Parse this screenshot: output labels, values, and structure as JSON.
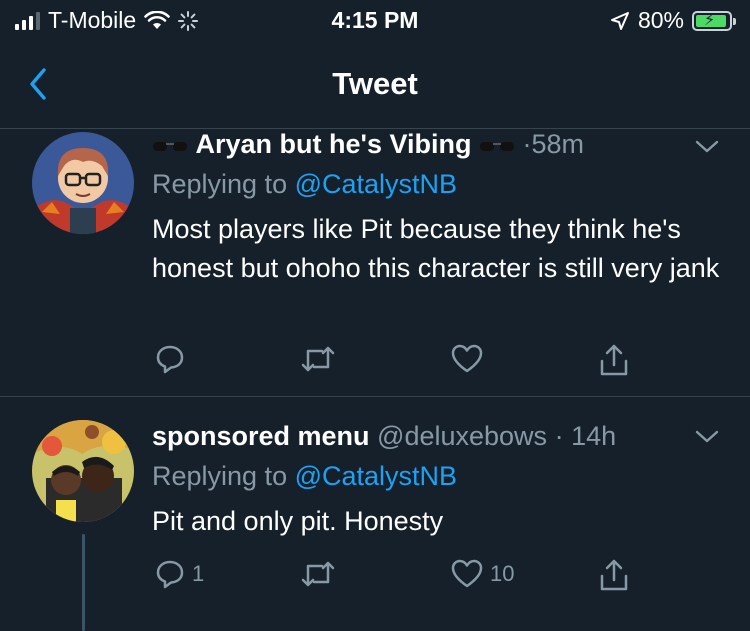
{
  "status_bar": {
    "carrier": "T-Mobile",
    "time": "4:15 PM",
    "battery_percent": "80%"
  },
  "header": {
    "title": "Tweet"
  },
  "tweets": [
    {
      "name": "Aryan but he's Vibing",
      "handle": "",
      "time": "58m",
      "reply_prefix": "Replying to",
      "mention": "@CatalystNB",
      "text": "Most players like Pit because they think he's honest but ohoho this character is still very jank",
      "reply_count": "",
      "like_count": ""
    },
    {
      "name": "sponsored menu",
      "handle": "@deluxebows",
      "time": "14h",
      "reply_prefix": "Replying to",
      "mention": "@CatalystNB",
      "text": "Pit and only pit. Honesty",
      "reply_count": "1",
      "like_count": "10"
    }
  ],
  "colors": {
    "background": "#15202b",
    "accent": "#1da1f2",
    "secondary_text": "#8899a6",
    "divider": "#38444d",
    "battery_fill": "#4cd964"
  },
  "icons": {
    "back": "chevron-left-icon",
    "more": "chevron-down-icon",
    "reply": "reply-icon",
    "retweet": "retweet-icon",
    "like": "heart-icon",
    "share": "share-icon"
  }
}
